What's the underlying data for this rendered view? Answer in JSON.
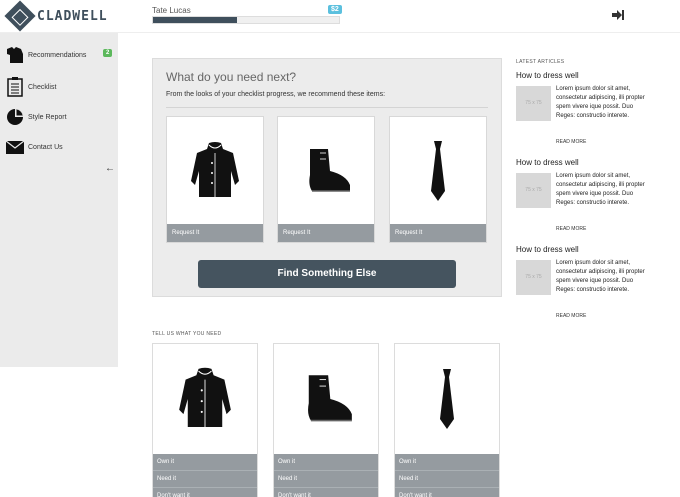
{
  "header": {
    "logo_text": "CLADWELL",
    "user_name": "Tate Lucas",
    "user_badge": "$2",
    "progress_fraction": 0.45
  },
  "sidebar": {
    "items": [
      {
        "label": "Recommendations",
        "badge": "2",
        "icon": "clothes-icon"
      },
      {
        "label": "Checklist",
        "icon": "checklist-icon"
      },
      {
        "label": "Style Report",
        "icon": "pie-chart-icon"
      },
      {
        "label": "Contact Us",
        "icon": "envelope-icon"
      }
    ],
    "collapse_icon": "arrow-left-icon"
  },
  "panel": {
    "title": "What do you need next?",
    "subtitle": "From the looks of your checklist progress, we recommend these items:",
    "cards": [
      {
        "item": "coat",
        "action": "Request It"
      },
      {
        "item": "boot",
        "action": "Request It"
      },
      {
        "item": "tie",
        "action": "Request It"
      }
    ],
    "button_label": "Find Something Else"
  },
  "tell": {
    "label": "TELL US WHAT YOU NEED",
    "cards": [
      {
        "item": "coat",
        "options": [
          "Own it",
          "Need it",
          "Don't want it"
        ]
      },
      {
        "item": "boot",
        "options": [
          "Own it",
          "Need it",
          "Don't want it"
        ]
      },
      {
        "item": "tie",
        "options": [
          "Own it",
          "Need it",
          "Don't want it"
        ]
      }
    ]
  },
  "articles": {
    "heading": "LATEST ARTICLES",
    "items": [
      {
        "title": "How to dress well",
        "thumb": "75 x 75",
        "body": "Lorem ipsum dolor sit amet, consectetur adipiscing, illi propter spem vivere ique possit. Duo Reges: constructio interete.",
        "more": "READ MORE"
      },
      {
        "title": "How to dress well",
        "thumb": "75 x 75",
        "body": "Lorem ipsum dolor sit amet, consectetur adipiscing, illi propter spem vivere ique possit. Duo Reges: constructio interete.",
        "more": "READ MORE"
      },
      {
        "title": "How to dress well",
        "thumb": "75 x 75",
        "body": "Lorem ipsum dolor sit amet, consectetur adipiscing, illi propter spem vivere ique possit. Duo Reges: constructio interete.",
        "more": "READ MORE"
      }
    ]
  },
  "colors": {
    "brand_dark": "#3f4f5c",
    "badge_blue": "#5bc0de",
    "badge_green": "#5cb85c",
    "card_footer": "#959ba0"
  }
}
